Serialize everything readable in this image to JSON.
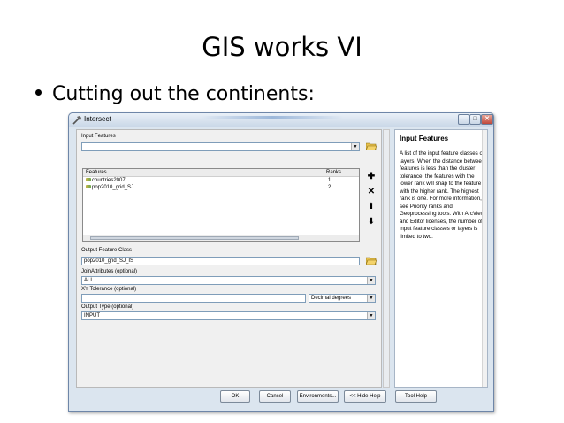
{
  "slide": {
    "title": "GIS works VI",
    "bullet": "Cutting out the continents:"
  },
  "dialog": {
    "title": "Intersect",
    "window_controls": [
      "minimize-icon",
      "maximize-icon",
      "close-icon"
    ],
    "input_features": {
      "label": "Input Features",
      "value": "",
      "table": {
        "headers": [
          "Features",
          "Ranks"
        ],
        "rows": [
          {
            "feature": "countries2007",
            "rank": "1"
          },
          {
            "feature": "pop2010_grid_SJ",
            "rank": "2"
          }
        ]
      }
    },
    "output_feature_class": {
      "label": "Output Feature Class",
      "value": "pop2010_grid_SJ_IS"
    },
    "join_attributes": {
      "label": "JoinAttributes (optional)",
      "value": "ALL"
    },
    "xy_tolerance": {
      "label": "XY Tolerance (optional)",
      "value": "",
      "unit": "Decimal degrees"
    },
    "output_type": {
      "label": "Output Type (optional)",
      "value": "INPUT"
    },
    "buttons": {
      "ok": "OK",
      "cancel": "Cancel",
      "environments": "Environments...",
      "hide_help": "<< Hide Help",
      "tool_help": "Tool Help"
    },
    "help": {
      "title": "Input Features",
      "body": "A list of the input feature classes or layers. When the distance between features is less than the cluster tolerance, the features with the lower rank will snap to the feature with the higher rank. The highest rank is one. For more information, see Priority ranks and Geoprocessing tools. With ArcView and Editor licenses, the number of input feature classes or layers is limited to two."
    }
  },
  "colors": {
    "window_frame": "#dbe5ef",
    "panel_bg": "#f0f0f0",
    "field_border": "#7f9db9"
  }
}
